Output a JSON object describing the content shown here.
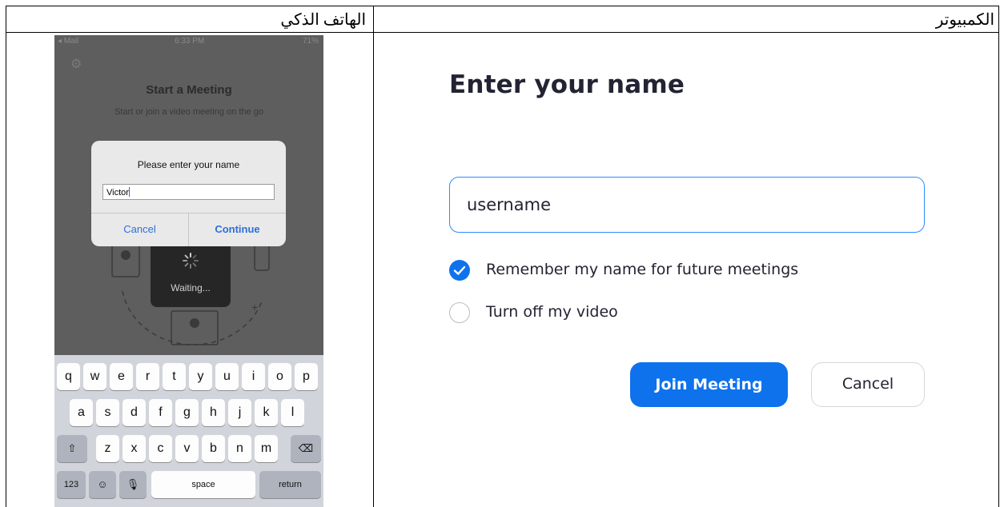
{
  "headers": {
    "phone": "الهاتف الذكي",
    "computer": "الكمبيوتر"
  },
  "phone": {
    "status": {
      "carrier": "◂ Mail",
      "time": "6:33 PM",
      "battery": "71%"
    },
    "title": "Start a Meeting",
    "subtitle": "Start or join a video meeting on the go",
    "dialog": {
      "title": "Please enter your name",
      "input_value": "Victor",
      "cancel": "Cancel",
      "continue": "Continue"
    },
    "waiting": "Waiting...",
    "keyboard": {
      "row1": [
        "q",
        "w",
        "e",
        "r",
        "t",
        "y",
        "u",
        "i",
        "o",
        "p"
      ],
      "row2": [
        "a",
        "s",
        "d",
        "f",
        "g",
        "h",
        "j",
        "k",
        "l"
      ],
      "row3": [
        "z",
        "x",
        "c",
        "v",
        "b",
        "n",
        "m"
      ],
      "shift": "⇧",
      "backspace": "⌫",
      "numbers": "123",
      "emoji": "☺",
      "mic": "🎙",
      "space": "space",
      "return": "return"
    },
    "colors": {
      "accent": "#2f6fd6"
    }
  },
  "desktop": {
    "title": "Enter your name",
    "name_input": "username",
    "remember_label": "Remember my name for future meetings",
    "remember_checked": true,
    "video_off_label": "Turn off my video",
    "video_off_checked": false,
    "join_button": "Join Meeting",
    "cancel_button": "Cancel",
    "colors": {
      "primary": "#0e72ed",
      "input_border": "#2d8cff",
      "text": "#232333"
    }
  }
}
